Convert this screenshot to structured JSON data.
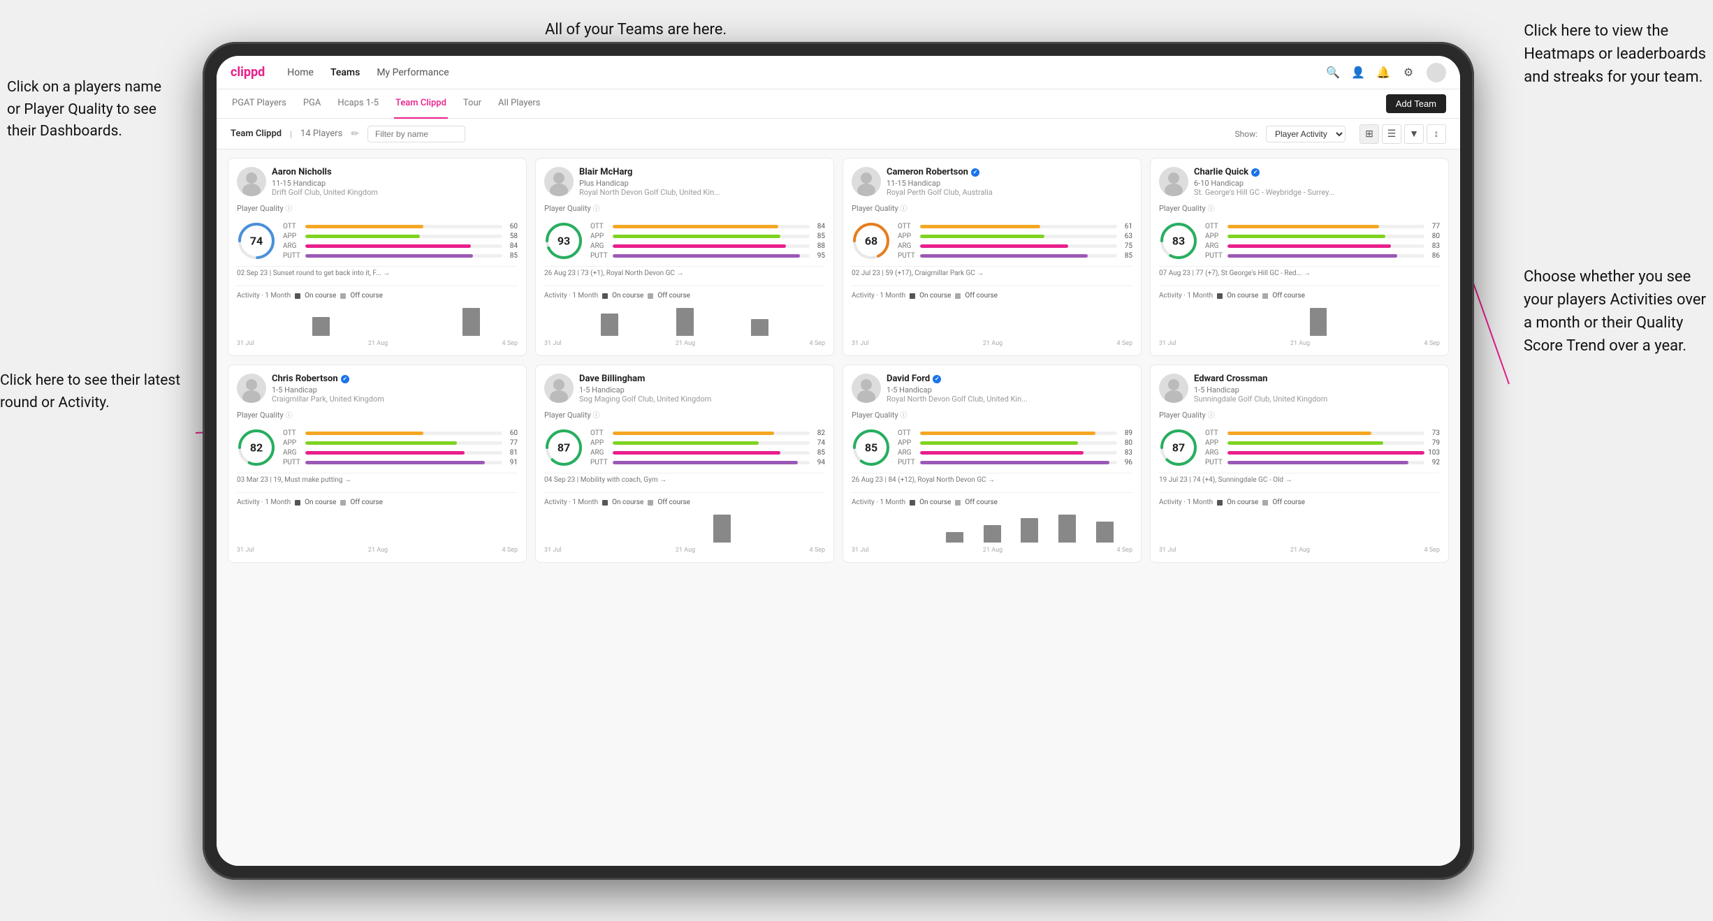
{
  "app": {
    "logo": "clippd",
    "nav_items": [
      "Home",
      "Teams",
      "My Performance"
    ],
    "nav_active": "Teams",
    "icons": [
      "search",
      "person",
      "bell",
      "settings",
      "avatar"
    ]
  },
  "sub_nav": {
    "items": [
      "PGAT Players",
      "PGA",
      "Hcaps 1-5",
      "Team Clippd",
      "Tour",
      "All Players"
    ],
    "active": "Team Clippd",
    "add_btn": "Add Team"
  },
  "team_bar": {
    "title": "Team Clippd",
    "count": "14 Players",
    "search_placeholder": "Filter by name",
    "show_label": "Show:",
    "show_option": "Player Activity",
    "filter_icon": "filter",
    "grid_icon": "grid"
  },
  "annotations": {
    "left_1": "Click on a players name\nor Player Quality to see\ntheir Dashboards.",
    "left_2": "Click here to see their latest\nround or Activity.",
    "top_center": "All of your Teams are here.",
    "top_right": "Click here to view the\nHeatmaps or leaderboards\nand streaks for your team.",
    "bottom_right": "Choose whether you see\nyour players Activities over\na month or their Quality\nScore Trend over a year."
  },
  "players": [
    {
      "id": 1,
      "name": "Aaron Nicholls",
      "handicap": "11-15 Handicap",
      "club": "Drift Golf Club, United Kingdom",
      "verified": false,
      "quality_score": 74,
      "quality_color": "#4a90d9",
      "stats": [
        {
          "label": "OTT",
          "color": "#f5a623",
          "value": 60
        },
        {
          "label": "APP",
          "color": "#7ed321",
          "value": 58
        },
        {
          "label": "ARG",
          "color": "#e91e8c",
          "value": 84
        },
        {
          "label": "PUTT",
          "color": "#9b59b6",
          "value": 85
        }
      ],
      "latest_round": "02 Sep 23 | Sunset round to get back into it, F... →",
      "chart_bars": [
        0,
        0,
        0,
        0,
        2,
        0,
        0,
        0,
        0,
        0,
        0,
        0,
        3,
        0,
        0
      ],
      "chart_dates": [
        "31 Jul",
        "21 Aug",
        "4 Sep"
      ]
    },
    {
      "id": 2,
      "name": "Blair McHarg",
      "handicap": "Plus Handicap",
      "club": "Royal North Devon Golf Club, United Kin...",
      "verified": false,
      "quality_score": 93,
      "quality_color": "#27ae60",
      "stats": [
        {
          "label": "OTT",
          "color": "#f5a623",
          "value": 84
        },
        {
          "label": "APP",
          "color": "#7ed321",
          "value": 85
        },
        {
          "label": "ARG",
          "color": "#e91e8c",
          "value": 88
        },
        {
          "label": "PUTT",
          "color": "#9b59b6",
          "value": 95
        }
      ],
      "latest_round": "26 Aug 23 | 73 (+1), Royal North Devon GC →",
      "chart_bars": [
        0,
        0,
        0,
        4,
        0,
        0,
        0,
        5,
        0,
        0,
        0,
        3,
        0,
        0,
        0
      ],
      "chart_dates": [
        "31 Jul",
        "21 Aug",
        "4 Sep"
      ]
    },
    {
      "id": 3,
      "name": "Cameron Robertson",
      "handicap": "11-15 Handicap",
      "club": "Royal Perth Golf Club, Australia",
      "verified": true,
      "quality_score": 68,
      "quality_color": "#e67e22",
      "stats": [
        {
          "label": "OTT",
          "color": "#f5a623",
          "value": 61
        },
        {
          "label": "APP",
          "color": "#7ed321",
          "value": 63
        },
        {
          "label": "ARG",
          "color": "#e91e8c",
          "value": 75
        },
        {
          "label": "PUTT",
          "color": "#9b59b6",
          "value": 85
        }
      ],
      "latest_round": "02 Jul 23 | 59 (+17), Craigmillar Park GC →",
      "chart_bars": [
        0,
        0,
        0,
        0,
        0,
        0,
        0,
        0,
        0,
        0,
        0,
        0,
        0,
        0,
        0
      ],
      "chart_dates": [
        "31 Jul",
        "21 Aug",
        "4 Sep"
      ]
    },
    {
      "id": 4,
      "name": "Charlie Quick",
      "handicap": "6-10 Handicap",
      "club": "St. George's Hill GC - Weybridge - Surrey...",
      "verified": true,
      "quality_score": 83,
      "quality_color": "#27ae60",
      "stats": [
        {
          "label": "OTT",
          "color": "#f5a623",
          "value": 77
        },
        {
          "label": "APP",
          "color": "#7ed321",
          "value": 80
        },
        {
          "label": "ARG",
          "color": "#e91e8c",
          "value": 83
        },
        {
          "label": "PUTT",
          "color": "#9b59b6",
          "value": 86
        }
      ],
      "latest_round": "07 Aug 23 | 77 (+7), St George's Hill GC - Red... →",
      "chart_bars": [
        0,
        0,
        0,
        0,
        0,
        0,
        0,
        0,
        3,
        0,
        0,
        0,
        0,
        0,
        0
      ],
      "chart_dates": [
        "31 Jul",
        "21 Aug",
        "4 Sep"
      ]
    },
    {
      "id": 5,
      "name": "Chris Robertson",
      "handicap": "1-5 Handicap",
      "club": "Craigmillar Park, United Kingdom",
      "verified": true,
      "quality_score": 82,
      "quality_color": "#27ae60",
      "stats": [
        {
          "label": "OTT",
          "color": "#f5a623",
          "value": 60
        },
        {
          "label": "APP",
          "color": "#7ed321",
          "value": 77
        },
        {
          "label": "ARG",
          "color": "#e91e8c",
          "value": 81
        },
        {
          "label": "PUTT",
          "color": "#9b59b6",
          "value": 91
        }
      ],
      "latest_round": "03 Mar 23 | 19, Must make putting →",
      "chart_bars": [
        0,
        0,
        0,
        0,
        0,
        0,
        0,
        0,
        0,
        0,
        0,
        0,
        0,
        0,
        0
      ],
      "chart_dates": [
        "31 Jul",
        "21 Aug",
        "4 Sep"
      ]
    },
    {
      "id": 6,
      "name": "Dave Billingham",
      "handicap": "1-5 Handicap",
      "club": "Sog Maging Golf Club, United Kingdom",
      "verified": false,
      "quality_score": 87,
      "quality_color": "#27ae60",
      "stats": [
        {
          "label": "OTT",
          "color": "#f5a623",
          "value": 82
        },
        {
          "label": "APP",
          "color": "#7ed321",
          "value": 74
        },
        {
          "label": "ARG",
          "color": "#e91e8c",
          "value": 85
        },
        {
          "label": "PUTT",
          "color": "#9b59b6",
          "value": 94
        }
      ],
      "latest_round": "04 Sep 23 | Mobility with coach, Gym →",
      "chart_bars": [
        0,
        0,
        0,
        0,
        0,
        0,
        0,
        0,
        0,
        4,
        0,
        0,
        0,
        0,
        0
      ],
      "chart_dates": [
        "31 Jul",
        "21 Aug",
        "4 Sep"
      ]
    },
    {
      "id": 7,
      "name": "David Ford",
      "handicap": "1-5 Handicap",
      "club": "Royal North Devon Golf Club, United Kin...",
      "verified": true,
      "quality_score": 85,
      "quality_color": "#27ae60",
      "stats": [
        {
          "label": "OTT",
          "color": "#f5a623",
          "value": 89
        },
        {
          "label": "APP",
          "color": "#7ed321",
          "value": 80
        },
        {
          "label": "ARG",
          "color": "#e91e8c",
          "value": 83
        },
        {
          "label": "PUTT",
          "color": "#9b59b6",
          "value": 96
        }
      ],
      "latest_round": "26 Aug 23 | 84 (+12), Royal North Devon GC →",
      "chart_bars": [
        0,
        0,
        0,
        0,
        0,
        3,
        0,
        5,
        0,
        7,
        0,
        8,
        0,
        6,
        0
      ],
      "chart_dates": [
        "31 Jul",
        "21 Aug",
        "4 Sep"
      ]
    },
    {
      "id": 8,
      "name": "Edward Crossman",
      "handicap": "1-5 Handicap",
      "club": "Sunningdale Golf Club, United Kingdom",
      "verified": false,
      "quality_score": 87,
      "quality_color": "#27ae60",
      "stats": [
        {
          "label": "OTT",
          "color": "#f5a623",
          "value": 73
        },
        {
          "label": "APP",
          "color": "#7ed321",
          "value": 79
        },
        {
          "label": "ARG",
          "color": "#e91e8c",
          "value": 103
        },
        {
          "label": "PUTT",
          "color": "#9b59b6",
          "value": 92
        }
      ],
      "latest_round": "19 Jul 23 | 74 (+4), Sunningdale GC - Old →",
      "chart_bars": [
        0,
        0,
        0,
        0,
        0,
        0,
        0,
        0,
        0,
        0,
        0,
        0,
        0,
        0,
        0
      ],
      "chart_dates": [
        "31 Jul",
        "21 Aug",
        "4 Sep"
      ]
    }
  ]
}
